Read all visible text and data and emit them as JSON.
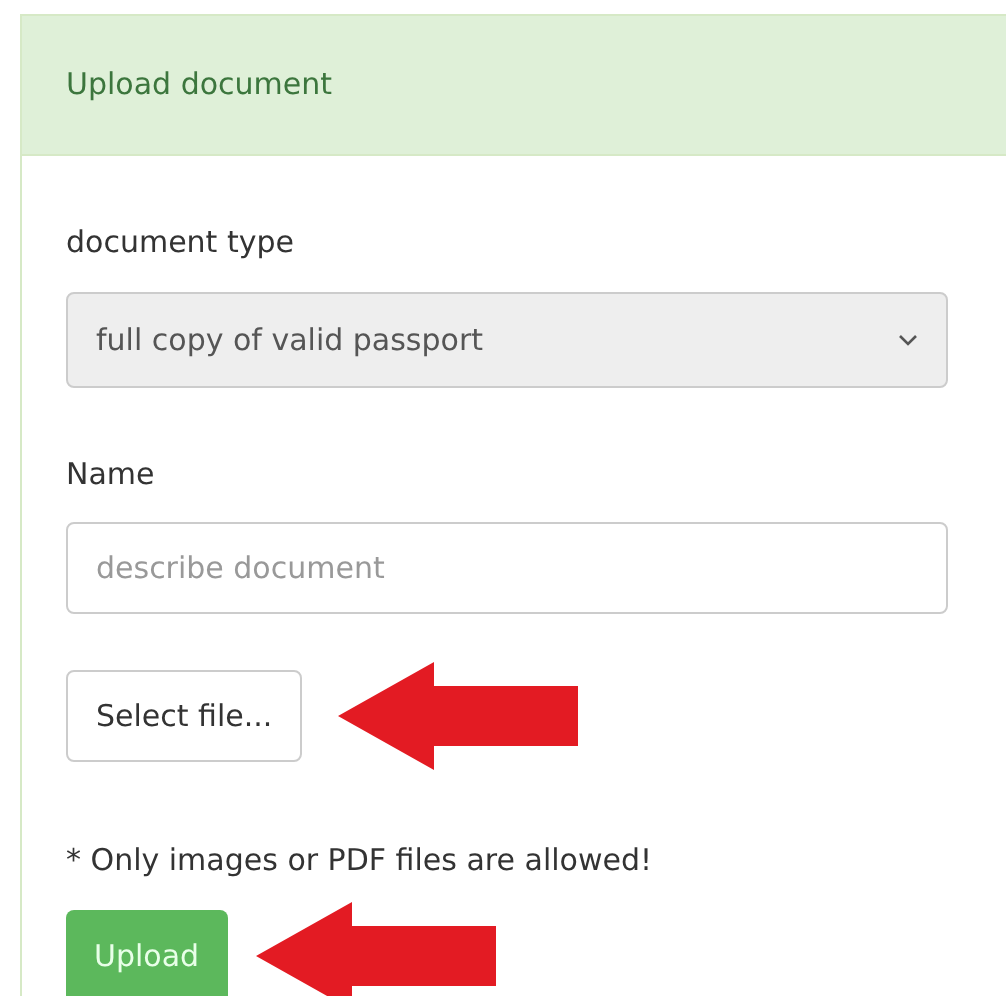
{
  "panel": {
    "title": "Upload document"
  },
  "document_type": {
    "label": "document type",
    "value": "full copy of valid passport"
  },
  "name": {
    "label": "Name",
    "placeholder": "describe document"
  },
  "select_file_button": "Select file...",
  "note": "* Only images or PDF files are allowed!",
  "upload_button": "Upload"
}
